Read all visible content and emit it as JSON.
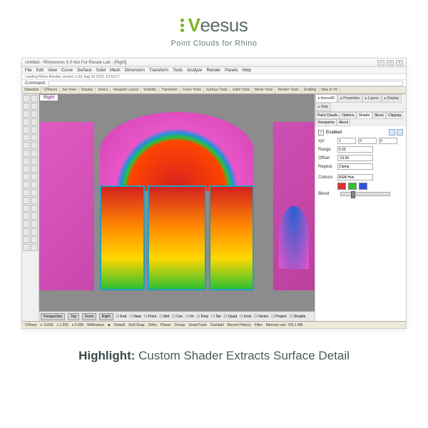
{
  "brand": {
    "name": "eesus",
    "sub": "Point Clouds for Rhino"
  },
  "window": {
    "title": "Untitled - Rhinoceros 5.0 Not For Resale Lab - [Right]"
  },
  "menubar": [
    "File",
    "Edit",
    "View",
    "Curve",
    "Surface",
    "Solid",
    "Mesh",
    "Dimension",
    "Transform",
    "Tools",
    "Analyze",
    "Render",
    "Panels",
    "Help"
  ],
  "loading": "Loading Rhino Render, version 1.50, Aug 10 2015, 10:15:17",
  "command_label": "Command:",
  "tool_tabs": [
    "Standard",
    "CPlanes",
    "Set View",
    "Display",
    "Select",
    "Viewport Layout",
    "Visibility",
    "Transform",
    "Curve Tools",
    "Surface Tools",
    "Solid Tools",
    "Mesh Tools",
    "Render Tools",
    "Drafting",
    "New in V5"
  ],
  "viewport": {
    "active": "Right",
    "bottom_tabs": [
      "Perspective",
      "Top",
      "Front",
      "Right"
    ]
  },
  "snap_row": [
    "End",
    "Near",
    "Point",
    "Mid",
    "Cen",
    "Int",
    "Perp",
    "Tan",
    "Quad",
    "Knot",
    "Vertex",
    "Project",
    "Disable"
  ],
  "panel": {
    "tabs": [
      "Arena4D",
      "Properties",
      "Layers",
      "Display",
      "Help"
    ],
    "subtabs": [
      "Point Clouds",
      "Options",
      "Shader",
      "Slices",
      "Clipping",
      "Viewpoints",
      "About"
    ],
    "enabled": "Enabled",
    "xyz_label": "xyz",
    "xyz": [
      "1",
      "0",
      "0"
    ],
    "range_label": "Range",
    "range": "0.25",
    "offset_label": "Offset",
    "offset": "-13.00",
    "repeat_label": "Repeat",
    "repeat": "Clamp",
    "colours_label": "Colours",
    "scheme": "RGB Hue",
    "blend_label": "Blend"
  },
  "statusbar": {
    "cplane": "CPlane",
    "x": "x -9.006",
    "y": "y 1.655",
    "z": "z 0.000",
    "units": "Millimeters",
    "layer": "Default",
    "items": [
      "Grid Snap",
      "Ortho",
      "Planar",
      "Osnap",
      "SmartTrack",
      "Gumball",
      "Record History",
      "Filter"
    ],
    "memory": "Memory use: 793.1 MB"
  },
  "caption": {
    "bold": "Highlight:",
    "rest": " Custom Shader Extracts Surface Detail"
  }
}
